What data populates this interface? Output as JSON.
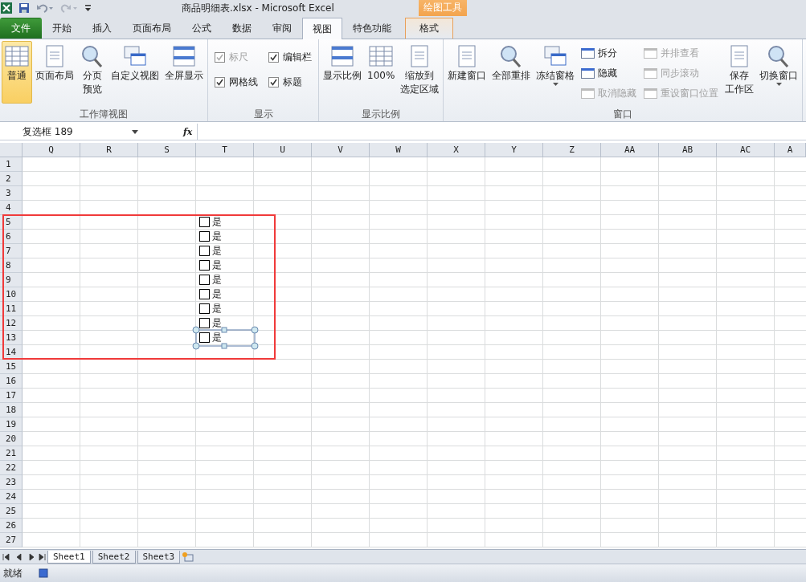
{
  "window": {
    "title": "商品明细表.xlsx  -  Microsoft Excel"
  },
  "contextual": {
    "header": "绘图工具"
  },
  "tabs": [
    {
      "label": "文件",
      "kind": "file",
      "selected": false
    },
    {
      "label": "开始",
      "kind": "normal",
      "selected": false
    },
    {
      "label": "插入",
      "kind": "normal",
      "selected": false
    },
    {
      "label": "页面布局",
      "kind": "normal",
      "selected": false
    },
    {
      "label": "公式",
      "kind": "normal",
      "selected": false
    },
    {
      "label": "数据",
      "kind": "normal",
      "selected": false
    },
    {
      "label": "审阅",
      "kind": "normal",
      "selected": false
    },
    {
      "label": "视图",
      "kind": "normal",
      "selected": true
    },
    {
      "label": "特色功能",
      "kind": "normal",
      "selected": false
    },
    {
      "label": "格式",
      "kind": "contextual",
      "selected": false
    }
  ],
  "ribbon": {
    "groups": [
      {
        "label": "工作簿视图",
        "items": [
          {
            "kind": "large",
            "lines": [
              "普通"
            ],
            "selected": true
          },
          {
            "kind": "large",
            "lines": [
              "页面布局"
            ],
            "selected": false
          },
          {
            "kind": "large",
            "lines": [
              "分页",
              "预览"
            ],
            "selected": false
          },
          {
            "kind": "large",
            "lines": [
              "自定义视图"
            ],
            "selected": false
          },
          {
            "kind": "large",
            "lines": [
              "全屏显示"
            ],
            "selected": false
          }
        ]
      },
      {
        "label": "显示",
        "items": [
          {
            "kind": "stack",
            "items": [
              {
                "kind": "check",
                "label": "标尺",
                "checked": true,
                "disabled": true
              },
              {
                "kind": "check",
                "label": "网格线",
                "checked": true,
                "disabled": false
              }
            ]
          },
          {
            "kind": "stack",
            "items": [
              {
                "kind": "check",
                "label": "编辑栏",
                "checked": true,
                "disabled": false
              },
              {
                "kind": "check",
                "label": "标题",
                "checked": true,
                "disabled": false
              }
            ]
          }
        ]
      },
      {
        "label": "显示比例",
        "items": [
          {
            "kind": "large",
            "lines": [
              "显示比例"
            ],
            "selected": false
          },
          {
            "kind": "large",
            "lines": [
              "100%"
            ],
            "selected": false
          },
          {
            "kind": "large",
            "lines": [
              "缩放到",
              "选定区域"
            ],
            "selected": false
          }
        ]
      },
      {
        "label": "窗口",
        "items": [
          {
            "kind": "large",
            "lines": [
              "新建窗口"
            ],
            "selected": false
          },
          {
            "kind": "large",
            "lines": [
              "全部重排"
            ],
            "selected": false
          },
          {
            "kind": "large",
            "lines": [
              "冻结窗格"
            ],
            "selected": false,
            "dropdown": true
          },
          {
            "kind": "stack",
            "items": [
              {
                "kind": "small",
                "label": "拆分",
                "disabled": false
              },
              {
                "kind": "small",
                "label": "隐藏",
                "disabled": false
              },
              {
                "kind": "small",
                "label": "取消隐藏",
                "disabled": true
              }
            ]
          },
          {
            "kind": "stack",
            "items": [
              {
                "kind": "small",
                "label": "并排查看",
                "disabled": true
              },
              {
                "kind": "small",
                "label": "同步滚动",
                "disabled": true
              },
              {
                "kind": "small",
                "label": "重设窗口位置",
                "disabled": true
              }
            ]
          },
          {
            "kind": "large",
            "lines": [
              "保存",
              "工作区"
            ],
            "selected": false
          },
          {
            "kind": "large",
            "lines": [
              "切换窗口"
            ],
            "selected": false,
            "dropdown": true
          }
        ]
      }
    ]
  },
  "formula_bar": {
    "name_box": "复选框 189",
    "fx": "fx"
  },
  "sheet": {
    "columns": [
      "Q",
      "R",
      "S",
      "T",
      "U",
      "V",
      "W",
      "X",
      "Y",
      "Z",
      "AA",
      "AB",
      "AC",
      "A"
    ],
    "rows": [
      "1",
      "2",
      "3",
      "4",
      "5",
      "6",
      "7",
      "8",
      "9",
      "10",
      "11",
      "12",
      "13",
      "14",
      "15",
      "16",
      "17",
      "18",
      "19",
      "20",
      "21",
      "22",
      "23",
      "24",
      "25",
      "26",
      "27"
    ],
    "checkboxes": [
      {
        "label": "是",
        "checked": false,
        "selected": false
      },
      {
        "label": "是",
        "checked": false,
        "selected": false
      },
      {
        "label": "是",
        "checked": false,
        "selected": false
      },
      {
        "label": "是",
        "checked": false,
        "selected": false
      },
      {
        "label": "是",
        "checked": false,
        "selected": false
      },
      {
        "label": "是",
        "checked": false,
        "selected": false
      },
      {
        "label": "是",
        "checked": false,
        "selected": false
      },
      {
        "label": "是",
        "checked": false,
        "selected": false
      },
      {
        "label": "是",
        "checked": false,
        "selected": true
      }
    ]
  },
  "sheet_tabs": [
    {
      "label": "Sheet1",
      "selected": true
    },
    {
      "label": "Sheet2",
      "selected": false
    },
    {
      "label": "Sheet3",
      "selected": false
    }
  ],
  "status_bar": {
    "text": "就绪"
  }
}
